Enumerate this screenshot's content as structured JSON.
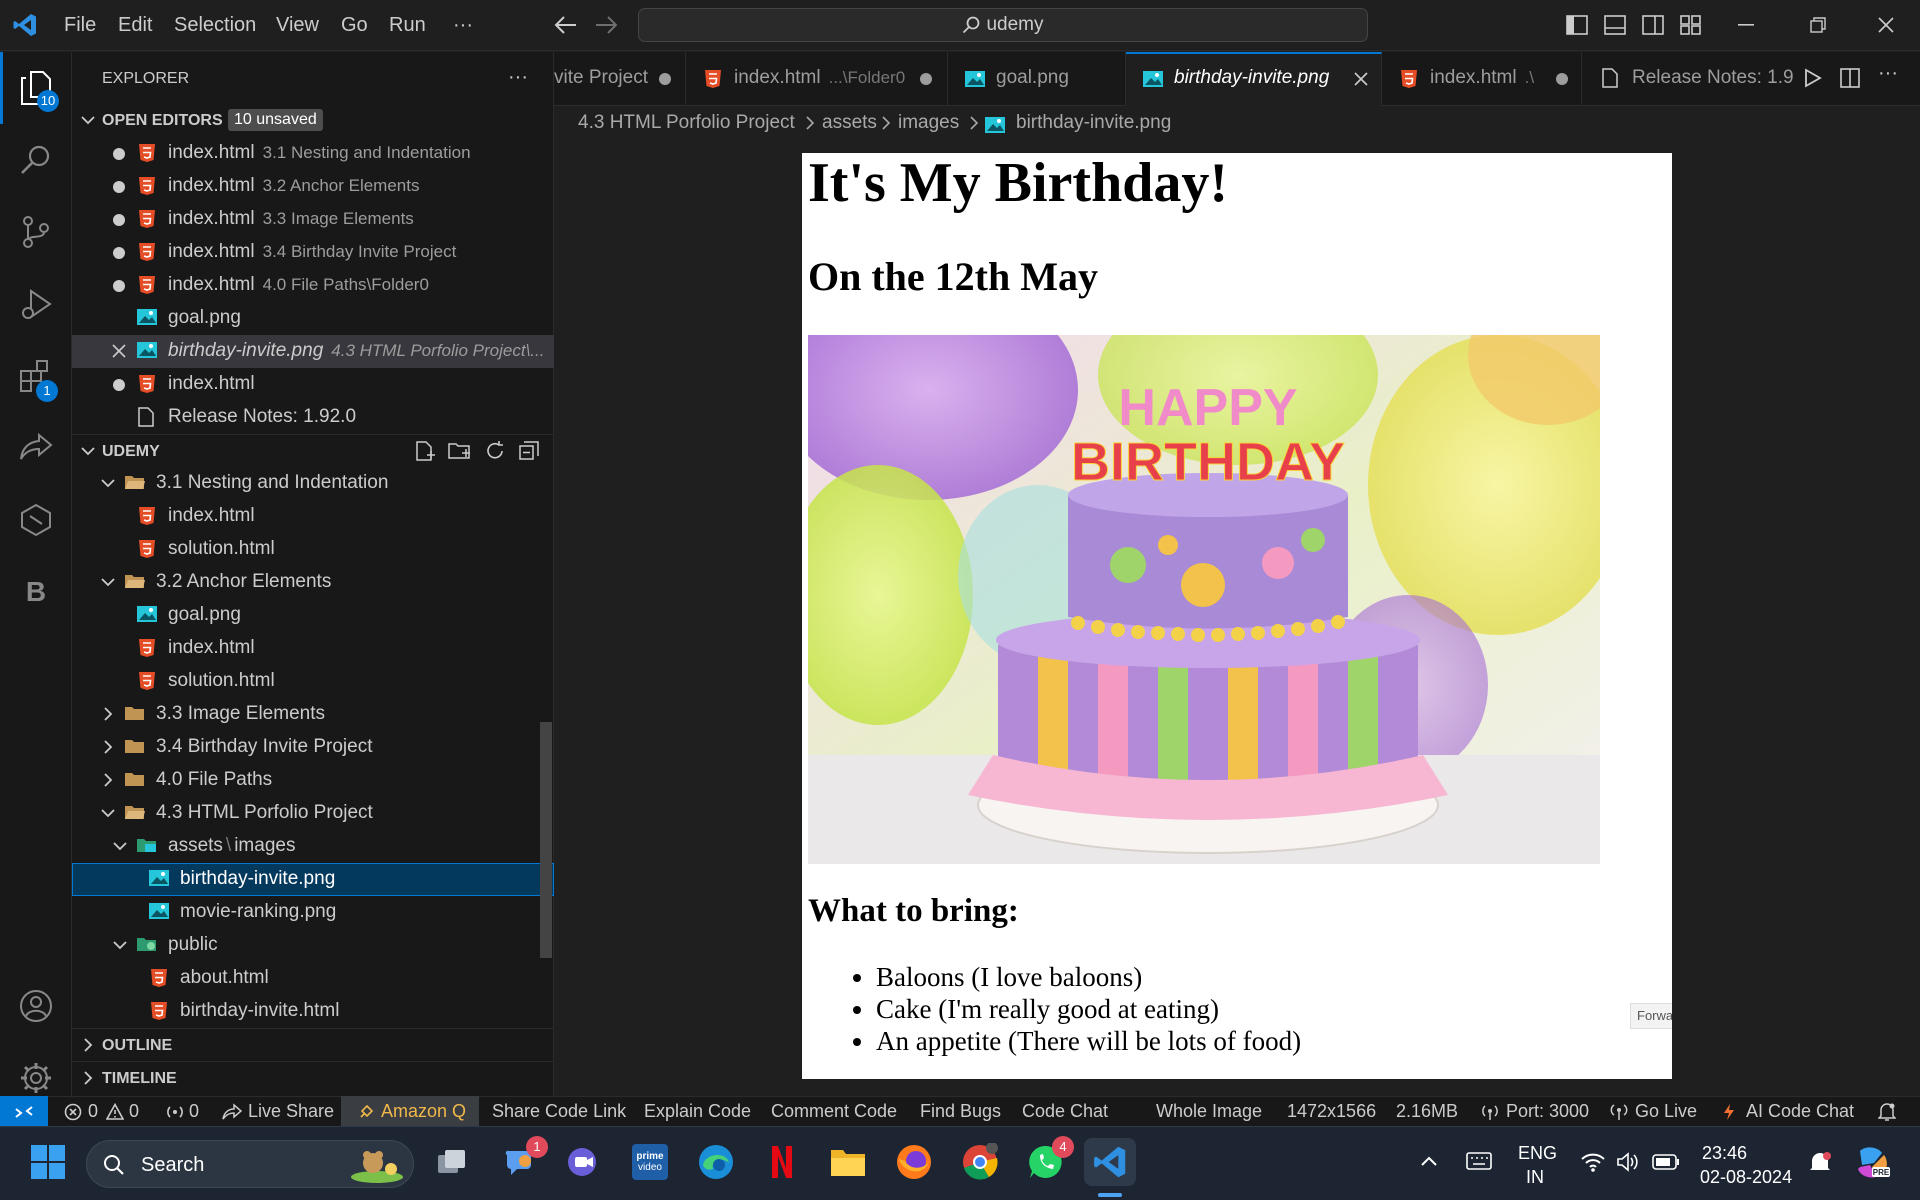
{
  "menu": [
    "File",
    "Edit",
    "Selection",
    "View",
    "Go",
    "Run",
    "···"
  ],
  "search": "udemy",
  "activity": {
    "explorer_badge": "10",
    "extensions_badge": "1",
    "account_label": "B"
  },
  "explorer": {
    "title": "EXPLORER",
    "open_editors": {
      "title": "OPEN EDITORS",
      "badge": "10 unsaved",
      "items": [
        {
          "name": "index.html",
          "desc": "3.1 Nesting and Indentation"
        },
        {
          "name": "index.html",
          "desc": "3.2 Anchor Elements"
        },
        {
          "name": "index.html",
          "desc": "3.3 Image Elements"
        },
        {
          "name": "index.html",
          "desc": "3.4 Birthday Invite Project"
        },
        {
          "name": "index.html",
          "desc": "4.0 File Paths\\Folder0"
        },
        {
          "name": "goal.png",
          "desc": ""
        },
        {
          "name": "birthday-invite.png",
          "desc": "4.3 HTML Porfolio Project\\..."
        },
        {
          "name": "index.html",
          "desc": ""
        },
        {
          "name": "Release Notes: 1.92.0",
          "desc": ""
        }
      ]
    },
    "workspace": {
      "title": "UDEMY",
      "items": [
        "3.1 Nesting and Indentation",
        "index.html",
        "solution.html",
        "3.2 Anchor Elements",
        "goal.png",
        "index.html",
        "solution.html",
        "3.3 Image Elements",
        "3.4 Birthday Invite Project",
        "4.0 File Paths",
        "4.3 HTML Porfolio Project",
        "assets",
        "\\",
        "images",
        "birthday-invite.png",
        "movie-ranking.png",
        "public",
        "about.html",
        "birthday-invite.html"
      ]
    },
    "outline": "OUTLINE",
    "timeline": "TIMELINE"
  },
  "tabs": [
    {
      "label": "vite Project",
      "desc": ""
    },
    {
      "label": "index.html",
      "desc": "...\\Folder0"
    },
    {
      "label": "goal.png",
      "desc": ""
    },
    {
      "label": "birthday-invite.png",
      "desc": ""
    },
    {
      "label": "index.html",
      "desc": ".\\"
    },
    {
      "label": "Release Notes: 1.9",
      "desc": ""
    }
  ],
  "breadcrumb": [
    "4.3 HTML Porfolio Project",
    "assets",
    "images",
    "birthday-invite.png"
  ],
  "preview": {
    "title": "It's My Birthday!",
    "subtitle": "On the 12th May",
    "cake_text_1": "HAPPY",
    "cake_text_2": "BIRTHDAY",
    "bring_heading": "What to bring:",
    "items": [
      "Baloons (I love baloons)",
      "Cake (I'm really good at eating)",
      "An appetite (There will be lots of food)"
    ],
    "tooltip": "Forwa"
  },
  "status": {
    "errors": "0",
    "warnings": "0",
    "ports": "0",
    "live_share": "Live Share",
    "amazon_q": "Amazon Q",
    "share_code_link": "Share Code Link",
    "explain_code": "Explain Code",
    "comment_code": "Comment Code",
    "find_bugs": "Find Bugs",
    "code_chat": "Code Chat",
    "whole_image": "Whole Image",
    "dims": "1472x1566",
    "size": "2.16MB",
    "port": "Port: 3000",
    "go_live": "Go Live",
    "ai_code_chat": "AI Code Chat"
  },
  "taskbar": {
    "search": "Search",
    "lang1": "ENG",
    "lang2": "IN",
    "time": "23:46",
    "date": "02-08-2024",
    "teams_badge": "1",
    "whatsapp_badge": "4"
  },
  "colors": {
    "accent": "#0078d4",
    "html_icon": "#e44d26",
    "image_icon": "#26c6da",
    "folder": "#c09553",
    "amazon_q": "#3a3d41"
  }
}
